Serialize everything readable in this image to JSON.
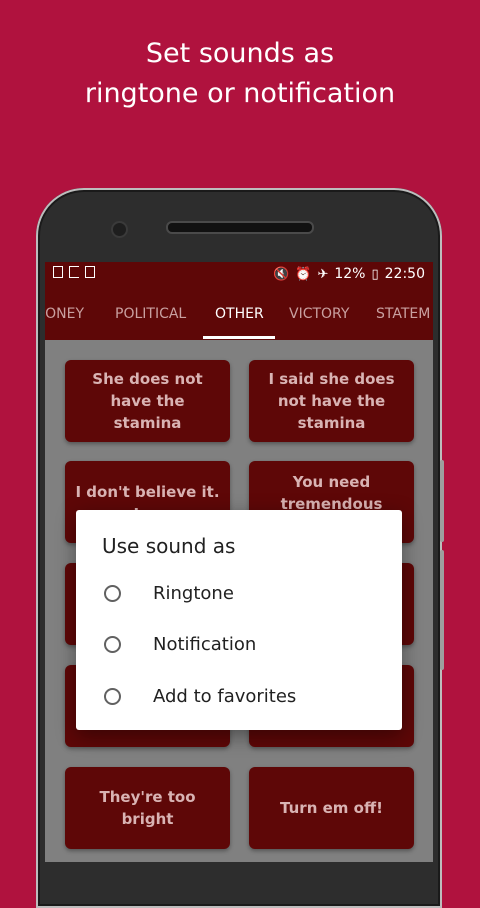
{
  "promo": {
    "line1": "Set sounds as",
    "line2": "ringtone or notification"
  },
  "status_bar": {
    "icons_left": [
      "image-icon",
      "cast-icon",
      "phone-icon"
    ],
    "icons_right": [
      "mute-icon",
      "alarm-icon",
      "airplane-icon"
    ],
    "battery": "12%",
    "time": "22:50"
  },
  "tabs": [
    {
      "label": "IONEY"
    },
    {
      "label": "POLITICAL"
    },
    {
      "label": "OTHER",
      "active": true
    },
    {
      "label": "VICTORY"
    },
    {
      "label": "STATEM"
    }
  ],
  "sound_cards": [
    "She does not have the stamina",
    "I said she does not have the stamina",
    "I don't believe it. I ...",
    "You need tremendous",
    "",
    "",
    "",
    "",
    "They're too bright",
    "Turn em off!"
  ],
  "dialog": {
    "title": "Use sound as",
    "options": [
      "Ringtone",
      "Notification",
      "Add to favorites"
    ]
  },
  "colors": {
    "background": "#b0123e",
    "app_bar": "#5e0707",
    "card": "#5e0707",
    "scrim_content": "#808080"
  }
}
